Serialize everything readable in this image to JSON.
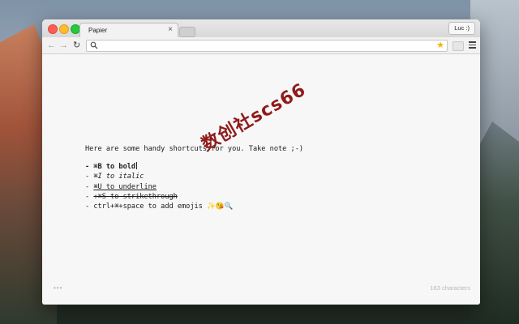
{
  "browser": {
    "tab_title": "Papier",
    "tab_close": "×",
    "profile_label": "Luc :)",
    "omnibox_value": "",
    "omnibox_placeholder": ""
  },
  "watermark": "数创社scs66",
  "note": {
    "intro": "Here are some handy shortcuts for you. Take note ;-)",
    "items": [
      {
        "prefix": "- ",
        "text": "⌘B to bold",
        "style": "bold"
      },
      {
        "prefix": "- ",
        "text": "⌘I to italic",
        "style": "italic"
      },
      {
        "prefix": "- ",
        "text": "⌘U to underline",
        "style": "underline"
      },
      {
        "prefix": "- ",
        "text": "⇧⌘S to strikethrough",
        "style": "strikethrough"
      },
      {
        "prefix": "- ",
        "text": "ctrl+⌘+space to add emojis ",
        "style": "plain"
      }
    ],
    "emojis": [
      "✨",
      "😘",
      "🔍"
    ]
  },
  "footer": {
    "more": "•••",
    "char_count": "163 characters"
  },
  "colors": {
    "close": "#fc5d57",
    "minimize": "#fdbc2e",
    "maximize": "#27c840",
    "watermark": "#8a1010"
  },
  "icons": [
    "back-arrow-icon",
    "forward-arrow-icon",
    "reload-icon",
    "search-icon",
    "star-icon",
    "extension-icon",
    "menu-icon"
  ]
}
